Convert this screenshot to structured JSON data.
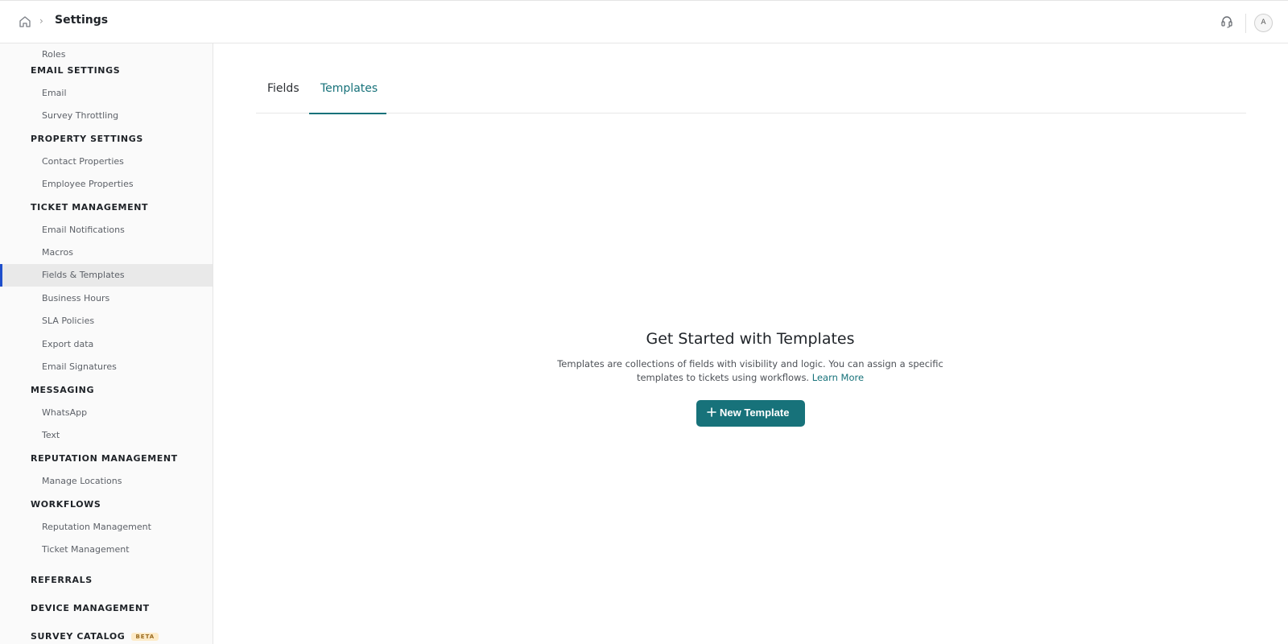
{
  "header": {
    "breadcrumb_title": "Settings",
    "avatar_initial": "A"
  },
  "sidebar": {
    "items": [
      {
        "type": "item",
        "label": "Roles"
      },
      {
        "type": "section",
        "label": "EMAIL SETTINGS"
      },
      {
        "type": "item",
        "label": "Email"
      },
      {
        "type": "item",
        "label": "Survey Throttling"
      },
      {
        "type": "section",
        "label": "PROPERTY SETTINGS"
      },
      {
        "type": "item",
        "label": "Contact Properties"
      },
      {
        "type": "item",
        "label": "Employee Properties"
      },
      {
        "type": "section",
        "label": "TICKET MANAGEMENT"
      },
      {
        "type": "item",
        "label": "Email Notifications"
      },
      {
        "type": "item",
        "label": "Macros"
      },
      {
        "type": "item",
        "label": "Fields & Templates",
        "active": true
      },
      {
        "type": "item",
        "label": "Business Hours"
      },
      {
        "type": "item",
        "label": "SLA Policies"
      },
      {
        "type": "item",
        "label": "Export data"
      },
      {
        "type": "item",
        "label": "Email Signatures"
      },
      {
        "type": "section",
        "label": "MESSAGING"
      },
      {
        "type": "item",
        "label": "WhatsApp"
      },
      {
        "type": "item",
        "label": "Text"
      },
      {
        "type": "section",
        "label": "REPUTATION MANAGEMENT"
      },
      {
        "type": "item",
        "label": "Manage Locations"
      },
      {
        "type": "section",
        "label": "WORKFLOWS"
      },
      {
        "type": "item",
        "label": "Reputation Management"
      },
      {
        "type": "item",
        "label": "Ticket Management"
      },
      {
        "type": "section",
        "label": "REFERRALS"
      },
      {
        "type": "section",
        "label": "DEVICE MANAGEMENT"
      },
      {
        "type": "section",
        "label": "SURVEY CATALOG",
        "badge": "BETA"
      }
    ]
  },
  "tabs": [
    {
      "label": "Fields",
      "active": false
    },
    {
      "label": "Templates",
      "active": true
    }
  ],
  "empty_state": {
    "title": "Get Started with Templates",
    "description": "Templates are collections of fields with visibility and logic. You can assign a specific templates to tickets using workflows.",
    "link_label": "Learn More",
    "button_label": "New Template"
  },
  "colors": {
    "accent": "#17727a",
    "active_indicator": "#1f4fcc",
    "beta_badge_bg": "#fdebc8"
  }
}
